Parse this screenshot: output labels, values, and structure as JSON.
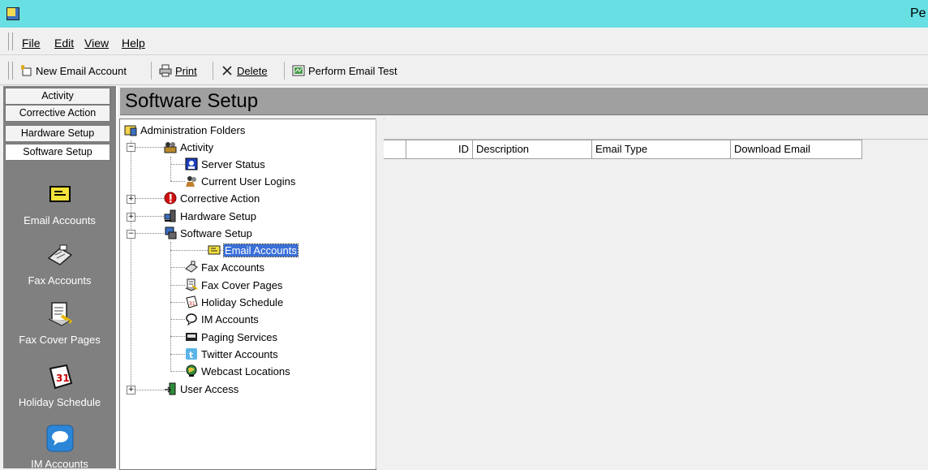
{
  "window": {
    "title": "Pe"
  },
  "menu": {
    "file": "File",
    "edit": "Edit",
    "view": "View",
    "help": "Help"
  },
  "toolbar": {
    "new_email_account": "New Email Account",
    "print": "Print",
    "delete": "Delete",
    "perform_email_test": "Perform Email Test"
  },
  "nav": {
    "tabs": [
      "Activity",
      "Corrective Action",
      "Hardware Setup",
      "Software Setup"
    ],
    "selected_tab": "Software Setup",
    "icons": [
      "Email Accounts",
      "Fax Accounts",
      "Fax Cover Pages",
      "Holiday Schedule",
      "IM Accounts"
    ]
  },
  "header": {
    "title": "Software Setup"
  },
  "tree": {
    "root": "Administration Folders",
    "activity": "Activity",
    "server_status": "Server Status",
    "current_user_logins": "Current User Logins",
    "corrective_action": "Corrective Action",
    "hardware_setup": "Hardware Setup",
    "software_setup": "Software Setup",
    "email_accounts": "Email Accounts",
    "fax_accounts": "Fax Accounts",
    "fax_cover_pages": "Fax Cover Pages",
    "holiday_schedule": "Holiday Schedule",
    "im_accounts": "IM Accounts",
    "paging_services": "Paging Services",
    "twitter_accounts": "Twitter Accounts",
    "webcast_locations": "Webcast Locations",
    "user_access": "User Access",
    "selected": "Email Accounts"
  },
  "grid": {
    "columns": [
      "ID",
      "Description",
      "Email Type",
      "Download Email"
    ]
  },
  "colors": {
    "titlebar": "#67dfe3",
    "selection": "#3a6fd8",
    "nav_bg": "#808080",
    "header_bg": "#a0a0a0"
  }
}
